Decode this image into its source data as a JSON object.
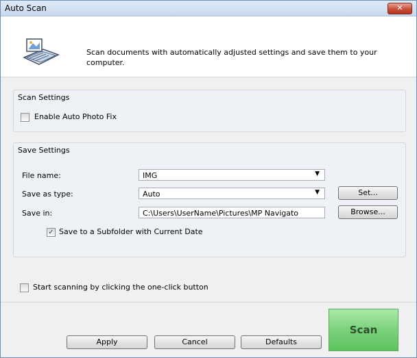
{
  "window": {
    "title": "Auto Scan",
    "close_label": "✕"
  },
  "header": {
    "icon": "scanner-document-icon",
    "description": "Scan documents with automatically adjusted settings and save them to your computer."
  },
  "scan_settings": {
    "title": "Scan Settings",
    "auto_photo_fix": {
      "label": "Enable Auto Photo Fix",
      "checked": false
    }
  },
  "save_settings": {
    "title": "Save Settings",
    "file_name": {
      "label": "File name:",
      "value": "IMG"
    },
    "save_as_type": {
      "label": "Save as type:",
      "value": "Auto",
      "set_button": "Set..."
    },
    "save_in": {
      "label": "Save in:",
      "value": "C:\\Users\\UserName\\Pictures\\MP Navigato",
      "browse_button": "Browse..."
    },
    "subfolder": {
      "label": "Save to a Subfolder with Current Date",
      "checked": true
    }
  },
  "one_click": {
    "label": "Start scanning by clicking the one-click button",
    "checked": false
  },
  "buttons": {
    "apply": "Apply",
    "cancel": "Cancel",
    "defaults": "Defaults",
    "scan": "Scan"
  },
  "glyphs": {
    "check": "✓",
    "dropdown": "▼"
  },
  "colors": {
    "scan_button": "#7fd47f",
    "title_bar": "#c8d9ee",
    "close_button": "#c7503a"
  }
}
